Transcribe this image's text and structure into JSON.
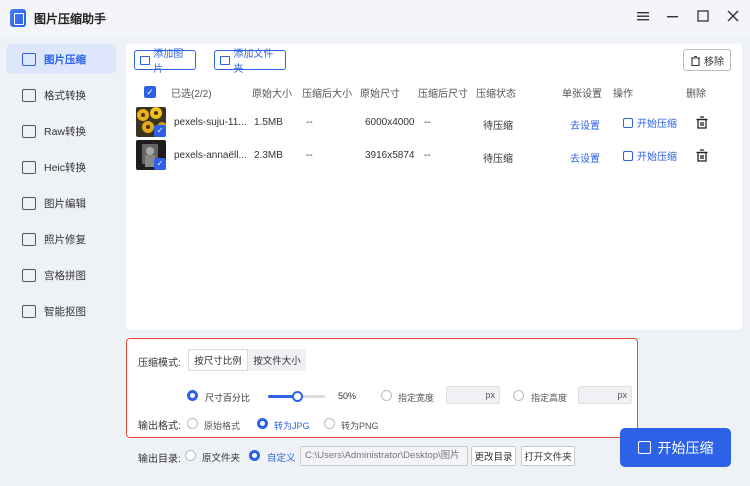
{
  "app": {
    "title": "图片压缩助手"
  },
  "sidebar": {
    "items": [
      {
        "label": "图片压缩",
        "icon": "image-compress-icon",
        "active": true
      },
      {
        "label": "格式转换",
        "icon": "format-convert-icon"
      },
      {
        "label": "Raw转换",
        "icon": "raw-icon"
      },
      {
        "label": "Heic转换",
        "icon": "heic-icon"
      },
      {
        "label": "图片编辑",
        "icon": "edit-icon"
      },
      {
        "label": "照片修复",
        "icon": "repair-icon"
      },
      {
        "label": "宫格拼图",
        "icon": "grid-icon"
      },
      {
        "label": "智能抠图",
        "icon": "cutout-icon"
      }
    ]
  },
  "toolbar": {
    "add_image": "添加图片",
    "add_folder": "添加文件夹",
    "remove": "移除"
  },
  "table": {
    "headers": {
      "selected": "已选(2/2)",
      "orig_size": "原始大小",
      "comp_size": "压缩后大小",
      "orig_dim": "原始尺寸",
      "comp_dim": "压缩后尺寸",
      "status": "压缩状态",
      "single": "单张设置",
      "ops": "操作",
      "delete": "删除"
    },
    "rows": [
      {
        "name": "pexels-suju-11...",
        "orig_size": "1.5MB",
        "comp_size": "--",
        "orig_dim": "6000x4000",
        "comp_dim": "--",
        "status": "待压缩",
        "setting": "去设置",
        "action": "开始压缩"
      },
      {
        "name": "pexels-annaëll...",
        "orig_size": "2.3MB",
        "comp_size": "--",
        "orig_dim": "3916x5874",
        "comp_dim": "--",
        "status": "待压缩",
        "setting": "去设置",
        "action": "开始压缩"
      }
    ]
  },
  "settings": {
    "mode_label": "压缩模式:",
    "mode_tabs": [
      "按尺寸比例",
      "按文件大小"
    ],
    "size_percent": "尺寸百分比",
    "percent_value": "50%",
    "percent_fraction": 0.5,
    "width_label": "指定宽度",
    "height_label": "指定高度",
    "unit": "px",
    "format_label": "输出格式:",
    "formats": [
      "原始格式",
      "转为JPG",
      "转为PNG"
    ]
  },
  "output": {
    "label": "输出目录:",
    "options": [
      "原文件夹",
      "自定义"
    ],
    "path": "C:\\Users\\Administrator\\Desktop\\图片",
    "change_dir": "更改目录",
    "open_folder": "打开文件夹"
  },
  "start_button": "开始压缩"
}
